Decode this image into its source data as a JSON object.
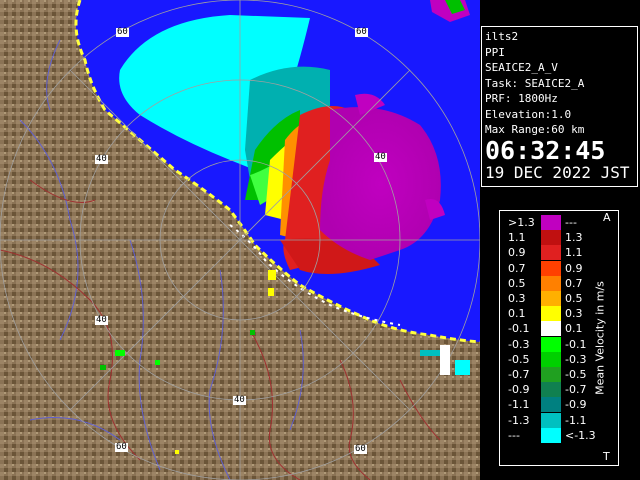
{
  "info": {
    "station": "ilts2",
    "mode": "PPI",
    "product": "SEAICE2_A_V",
    "task": "Task: SEAICE2_A",
    "prf": "PRF: 1800Hz",
    "elevation": "Elevation:1.0",
    "max_range": "Max Range:60 km",
    "time": "06:32:45",
    "date": "19 DEC 2022 JST"
  },
  "range_labels": [
    "60",
    "60",
    "40",
    "40",
    "40",
    "40",
    "60",
    "60"
  ],
  "legend": {
    "title": "Mean Velocity in m/s",
    "top_mark": "A",
    "bottom_mark": "T",
    "rows": [
      {
        "low": ">1.3",
        "high": "---",
        "color": "#c000c0"
      },
      {
        "low": "1.1",
        "high": "1.3",
        "color": "#c01010"
      },
      {
        "low": "0.9",
        "high": "1.1",
        "color": "#e02020"
      },
      {
        "low": "0.7",
        "high": "0.9",
        "color": "#ff4000"
      },
      {
        "low": "0.5",
        "high": "0.7",
        "color": "#ff8000"
      },
      {
        "low": "0.3",
        "high": "0.5",
        "color": "#ffb000"
      },
      {
        "low": "0.1",
        "high": "0.3",
        "color": "#ffff00"
      },
      {
        "low": "-0.1",
        "high": "0.1",
        "color": "#ffffff"
      },
      {
        "low": "-0.3",
        "high": "-0.1",
        "color": "#00ff00"
      },
      {
        "low": "-0.5",
        "high": "-0.3",
        "color": "#00d000"
      },
      {
        "low": "-0.7",
        "high": "-0.5",
        "color": "#20a020"
      },
      {
        "low": "-0.9",
        "high": "-0.7",
        "color": "#108050"
      },
      {
        "low": "-1.1",
        "high": "-0.9",
        "color": "#008080"
      },
      {
        "low": "-1.3",
        "high": "-1.1",
        "color": "#00c0c0"
      },
      {
        "low": "---",
        "high": "<-1.3",
        "color": "#00ffff"
      }
    ]
  },
  "colors": {
    "sea": "#1818ff",
    "land": "#8b7355",
    "land_dark": "#6b5538",
    "rivers": "#6060d0",
    "boundaries": "#a03030",
    "range_rings": "#a0a0a0",
    "coast": "#ffff40"
  }
}
